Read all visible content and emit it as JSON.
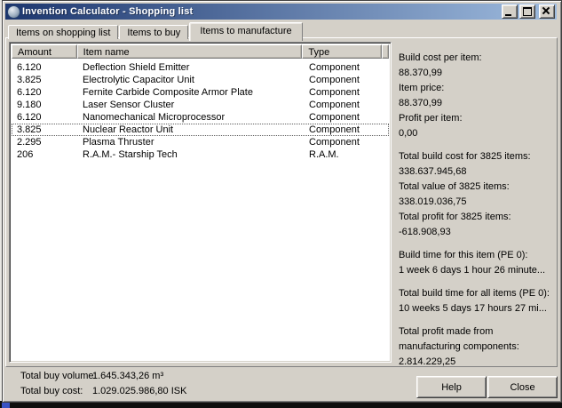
{
  "titlebar": {
    "title": "Invention Calculator - Shopping list"
  },
  "tabs": [
    {
      "label": "Items on shopping list",
      "active": false
    },
    {
      "label": "Items to buy",
      "active": false
    },
    {
      "label": "Items to manufacture",
      "active": true
    }
  ],
  "table": {
    "columns": [
      "Amount",
      "Item name",
      "Type"
    ],
    "rows": [
      {
        "amount": "6.120",
        "name": "Deflection Shield Emitter",
        "type": "Component",
        "selected": false
      },
      {
        "amount": "3.825",
        "name": "Electrolytic Capacitor Unit",
        "type": "Component",
        "selected": false
      },
      {
        "amount": "6.120",
        "name": "Fernite Carbide Composite Armor Plate",
        "type": "Component",
        "selected": false
      },
      {
        "amount": "9.180",
        "name": "Laser Sensor Cluster",
        "type": "Component",
        "selected": false
      },
      {
        "amount": "6.120",
        "name": "Nanomechanical Microprocessor",
        "type": "Component",
        "selected": false
      },
      {
        "amount": "3.825",
        "name": "Nuclear Reactor Unit",
        "type": "Component",
        "selected": true
      },
      {
        "amount": "2.295",
        "name": "Plasma Thruster",
        "type": "Component",
        "selected": false
      },
      {
        "amount": "206",
        "name": "R.A.M.- Starship Tech",
        "type": "R.A.M.",
        "selected": false
      }
    ]
  },
  "info_panel": {
    "paragraphs": [
      [
        "Build cost per item:",
        "88.370,99",
        "Item price:",
        "88.370,99",
        "Profit per item:",
        "0,00"
      ],
      [
        "Total build cost for 3825 items:",
        "338.637.945,68",
        "Total value of 3825 items:",
        "338.019.036,75",
        "Total profit for 3825 items:",
        "-618.908,93"
      ],
      [
        "Build time for this item (PE 0):",
        "1 week 6 days 1 hour 26 minute..."
      ],
      [
        "Total build time for all items (PE 0):",
        "10 weeks 5 days 17 hours 27 mi..."
      ],
      [
        "Total profit made from",
        "manufacturing components:",
        "2.814.229,25"
      ]
    ]
  },
  "status": {
    "volume_label": "Total buy volume:",
    "volume_value": "1.645.343,26 m³",
    "cost_label": "Total buy cost:",
    "cost_value": "1.029.025.986,80 ISK"
  },
  "action_buttons": {
    "help": "Help",
    "close": "Close"
  },
  "colors": {
    "titlebar_gradient_left": "#1c366e",
    "titlebar_gradient_right": "#9fbcdf",
    "dialog_face": "#d4d0c8",
    "listview_bg": "#ffffff",
    "text": "#000000"
  }
}
